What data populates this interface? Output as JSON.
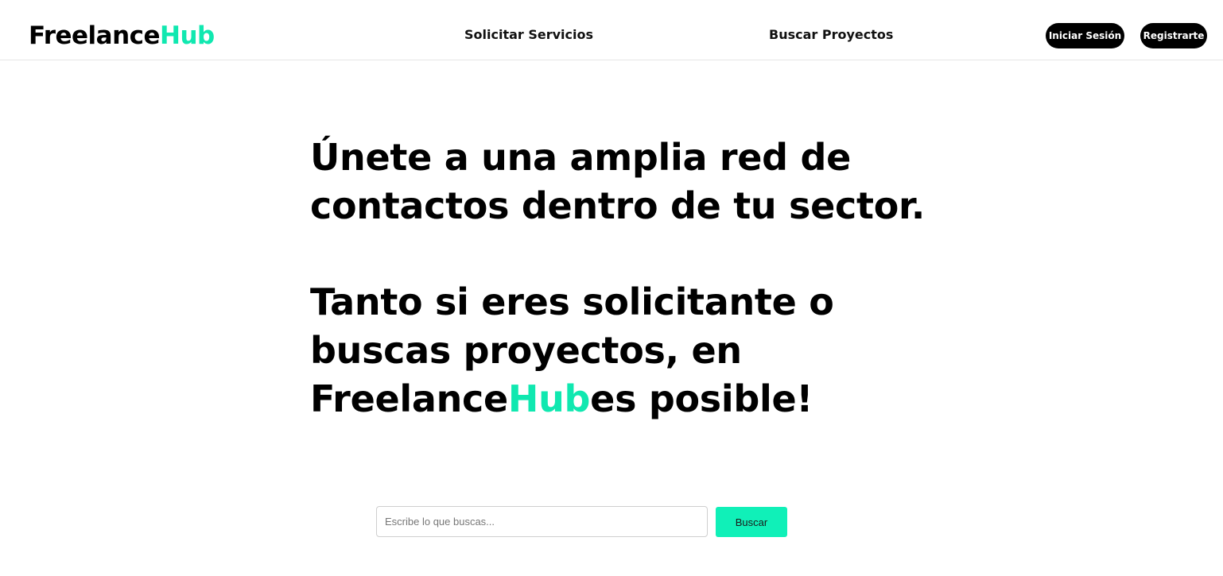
{
  "brand": {
    "name_main": "Freelance",
    "name_accent": "Hub",
    "accent_color": "#10e8b0"
  },
  "nav": {
    "solicitar": "Solicitar Servicios",
    "buscar": "Buscar Proyectos"
  },
  "auth": {
    "login": "Iniciar Sesión",
    "register": "Registrarte"
  },
  "hero": {
    "line1": "Únete a una amplia red de",
    "line2": "contactos dentro de tu sector.",
    "line3": "Tanto si eres solicitante o",
    "line4": "buscas proyectos, en",
    "line5_main": "Freelance",
    "line5_accent": "Hub",
    "line5_tail": "es posible!"
  },
  "search": {
    "placeholder": "Escribe lo que buscas...",
    "button": "Buscar",
    "button_color": "#10f0b8"
  }
}
